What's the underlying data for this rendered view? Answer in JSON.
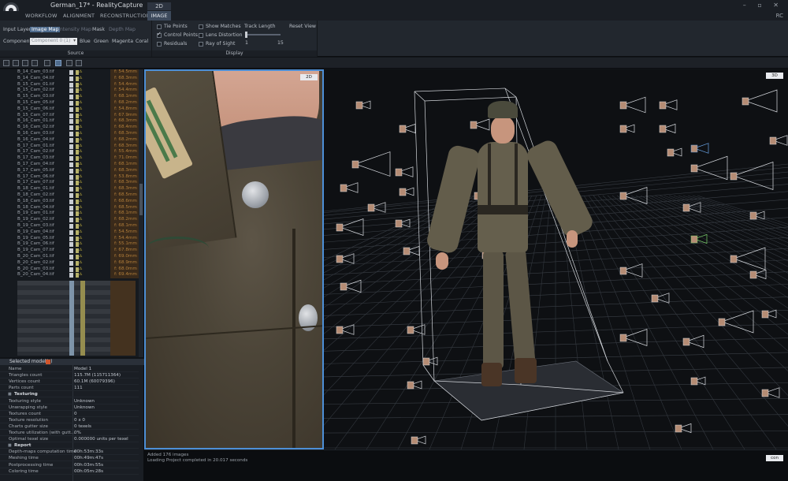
{
  "window": {
    "title": "German_17* - RealityCapture",
    "controls": "– ▫ ✕",
    "rc_label": "RC"
  },
  "menu": {
    "tabs": [
      "WORKFLOW",
      "ALIGNMENT",
      "RECONSTRUCTION"
    ],
    "mode_label": "2D",
    "active_tab": "IMAGE"
  },
  "ribbon": {
    "source": {
      "input_layer": "Input Layer",
      "image_map": "Image Map",
      "intensity_map": "Intensity Map",
      "mask": "Mask",
      "depth_map": "Depth Map",
      "component_label": "Component",
      "component_value": "Component 0 (1)",
      "colors": [
        "Blue",
        "Green",
        "Magenta",
        "Coral"
      ],
      "caption": "Source"
    },
    "display": {
      "tie_points": "Tie Points",
      "control_points": "Control Points",
      "residuals": "Residuals",
      "show_matches": "Show Matches",
      "lens_distortion": "Lens Distortion",
      "ray_of_sight": "Ray of Sight",
      "track_length": "Track Length",
      "track_min": "1",
      "track_max": "15",
      "reset_view": "Reset View",
      "caption": "Display"
    }
  },
  "images": [
    {
      "name": "B_14_Cam_03.tif",
      "focal": "f: 54.5mm"
    },
    {
      "name": "B_14_Cam_04.tif",
      "focal": "f: 68.3mm"
    },
    {
      "name": "B_15_Cam_01.tif",
      "focal": "f: 54.4mm"
    },
    {
      "name": "B_15_Cam_02.tif",
      "focal": "f: 54.4mm"
    },
    {
      "name": "B_15_Cam_03.tif",
      "focal": "f: 68.1mm"
    },
    {
      "name": "B_15_Cam_05.tif",
      "focal": "f: 68.2mm"
    },
    {
      "name": "B_15_Cam_06.tif",
      "focal": "f: 54.8mm"
    },
    {
      "name": "B_15_Cam_07.tif",
      "focal": "f: 67.9mm"
    },
    {
      "name": "B_16_Cam_01.tif",
      "focal": "f: 68.3mm"
    },
    {
      "name": "B_16_Cam_02.tif",
      "focal": "f: 68.4mm"
    },
    {
      "name": "B_16_Cam_03.tif",
      "focal": "f: 68.3mm"
    },
    {
      "name": "B_16_Cam_04.tif",
      "focal": "f: 68.2mm"
    },
    {
      "name": "B_17_Cam_01.tif",
      "focal": "f: 68.3mm"
    },
    {
      "name": "B_17_Cam_02.tif",
      "focal": "f: 55.4mm"
    },
    {
      "name": "B_17_Cam_03.tif",
      "focal": "f: 71.0mm"
    },
    {
      "name": "B_17_Cam_04.tif",
      "focal": "f: 68.1mm"
    },
    {
      "name": "B_17_Cam_05.tif",
      "focal": "f: 68.3mm"
    },
    {
      "name": "B_17_Cam_06.tif",
      "focal": "f: 53.8mm"
    },
    {
      "name": "B_17_Cam_07.tif",
      "focal": "f: 68.3mm"
    },
    {
      "name": "B_18_Cam_01.tif",
      "focal": "f: 68.3mm"
    },
    {
      "name": "B_18_Cam_02.tif",
      "focal": "f: 68.5mm"
    },
    {
      "name": "B_18_Cam_03.tif",
      "focal": "f: 68.6mm"
    },
    {
      "name": "B_18_Cam_04.tif",
      "focal": "f: 68.5mm"
    },
    {
      "name": "B_19_Cam_01.tif",
      "focal": "f: 68.1mm"
    },
    {
      "name": "B_19_Cam_02.tif",
      "focal": "f: 68.2mm"
    },
    {
      "name": "B_19_Cam_03.tif",
      "focal": "f: 68.1mm"
    },
    {
      "name": "B_19_Cam_04.tif",
      "focal": "f: 54.5mm"
    },
    {
      "name": "B_19_Cam_05.tif",
      "focal": "f: 54.4mm"
    },
    {
      "name": "B_19_Cam_06.tif",
      "focal": "f: 55.1mm"
    },
    {
      "name": "B_19_Cam_07.tif",
      "focal": "f: 67.8mm"
    },
    {
      "name": "B_20_Cam_01.tif",
      "focal": "f: 69.0mm"
    },
    {
      "name": "B_20_Cam_02.tif",
      "focal": "f: 68.9mm"
    },
    {
      "name": "B_20_Cam_03.tif",
      "focal": "f: 68.0mm"
    },
    {
      "name": "B_20_Cam_04.tif",
      "focal": "f: 69.4mm"
    }
  ],
  "list_header_badge": "1Ds",
  "selected_model": {
    "header": "Selected model(s)",
    "rows": [
      {
        "k": "Name",
        "v": "Model 1"
      },
      {
        "k": "Triangles count",
        "v": "115.7M (115711364)"
      },
      {
        "k": "Vertices count",
        "v": "60.1M (60079396)"
      },
      {
        "k": "Parts count",
        "v": "111"
      },
      {
        "k": "Texturing",
        "v": "",
        "section": true
      },
      {
        "k": "Texturing style",
        "v": "Unknown"
      },
      {
        "k": "Unwrapping style",
        "v": "Unknown"
      },
      {
        "k": "Textures count",
        "v": "0"
      },
      {
        "k": "Texture resolution",
        "v": "0 x 0"
      },
      {
        "k": "Charts gutter size",
        "v": "0 texels"
      },
      {
        "k": "Texture utilization (with gutt...",
        "v": "0%"
      },
      {
        "k": "Optimal texel size",
        "v": "0.000000 units per texel"
      },
      {
        "k": "Report",
        "v": "",
        "section": true
      },
      {
        "k": "Depth-maps computation time",
        "v": "00h:53m:33s"
      },
      {
        "k": "Meshing time",
        "v": "00h:49m:47s"
      },
      {
        "k": "Postprocessing time",
        "v": "00h:03m:55s"
      },
      {
        "k": "Coloring time",
        "v": "00h:05m:28s"
      }
    ]
  },
  "view2d": {
    "badge": "2D"
  },
  "view3d": {
    "badge": "3D"
  },
  "console": {
    "lines": [
      "Added 176 images",
      "Loading Project completed in 20.017 seconds"
    ],
    "badge": "con"
  },
  "colors": {
    "accent": "#4d8fd6",
    "panel": "#22272e",
    "background": "#111418",
    "focal_text": "#b27e3a",
    "warning": "#d8c440"
  }
}
